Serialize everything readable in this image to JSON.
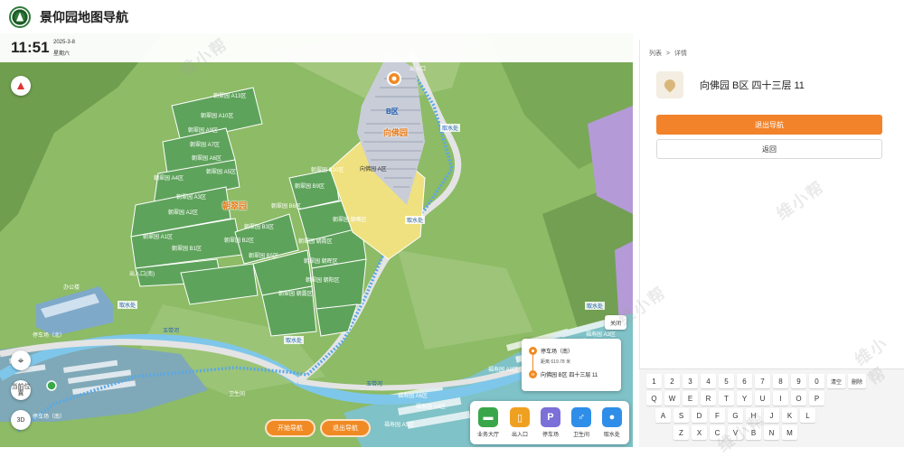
{
  "header": {
    "title": "景仰园地图导航",
    "brand_color": "#2f7a3a"
  },
  "clock": {
    "time": "11:51",
    "date": "2025-3-8",
    "weekday": "星期六"
  },
  "map_controls": {
    "locate_label": "当前位置",
    "mode_label": "3D"
  },
  "map": {
    "area_labels": [
      "朝翠园 A13区",
      "朝翠园 A10区",
      "朝翠园 A9区",
      "朝翠园 A7区",
      "朝翠园 A6区",
      "朝翠园 A5区",
      "朝翠园 A4区",
      "朝翠园 A3区",
      "朝翠园 A2区",
      "朝翠园 A1区",
      "朝翠园 B1区",
      "朝翠园 B2区",
      "朝翠园 B3区",
      "朝翠园 B5区",
      "朝翠园 B6区",
      "朝翠园 B9区",
      "朝翠园 B10区",
      "朝翠园 朝曦区",
      "朝翠园 朝霞区",
      "朝翠园 朝晖区",
      "朝翠园 朝露区",
      "朝翠园 朝阳区",
      "向佛园 A区"
    ],
    "zone_titles": {
      "chaocui": "朝翠园",
      "xiangfo": "向佛园"
    },
    "markers": {
      "b_zone": "B区",
      "entrance_north": "出入口",
      "entrance_south": "出入口(南)",
      "office": "办公楼",
      "parking_north": "停车场（北）",
      "parking_south": "停车场（南）",
      "toilet": "卫生间",
      "river_1": "玉带河",
      "river_2": "玉带河",
      "water_points": [
        "取水处",
        "取水处",
        "取水处",
        "取水处",
        "取水处"
      ],
      "fuyuan": [
        "福寿园 A3区",
        "福寿园 A4区",
        "福寿园 A5区",
        "福寿园 A6区",
        "福寿园 A8区"
      ]
    },
    "close_label": "关闭"
  },
  "route": {
    "start": "停车场（南）",
    "distance": "距离 619.78 米",
    "end": "向佛园 B区 四十三层 11",
    "route_color": "#f08a24"
  },
  "nav_buttons": {
    "start": "开始导航",
    "exit": "退出导航"
  },
  "poi_bar": [
    {
      "label": "业务大厅",
      "icon": "hall-icon",
      "color": "#3aa64a",
      "glyph": "▬"
    },
    {
      "label": "出入口",
      "icon": "door-icon",
      "color": "#f0a020",
      "glyph": "▯"
    },
    {
      "label": "停车场",
      "icon": "parking-icon",
      "color": "#7b6fd8",
      "glyph": "P"
    },
    {
      "label": "卫生间",
      "icon": "toilet-icon",
      "color": "#2f8ee8",
      "glyph": "♂"
    },
    {
      "label": "取水处",
      "icon": "water-icon",
      "color": "#2f8ee8",
      "glyph": "●"
    }
  ],
  "panel": {
    "breadcrumb": [
      "列表",
      ">",
      "详情"
    ],
    "place_name": "向佛园 B区 四十三层 11",
    "exit_button": "退出导航",
    "back_button": "返回",
    "watermark": "维小帮"
  },
  "keyboard": {
    "row1": [
      "1",
      "2",
      "3",
      "4",
      "5",
      "6",
      "7",
      "8",
      "9",
      "0",
      "清空",
      "删除"
    ],
    "row2": [
      "Q",
      "W",
      "E",
      "R",
      "T",
      "Y",
      "U",
      "I",
      "O",
      "P"
    ],
    "row3": [
      "A",
      "S",
      "D",
      "F",
      "G",
      "H",
      "J",
      "K",
      "L"
    ],
    "row4": [
      "Z",
      "X",
      "C",
      "V",
      "B",
      "N",
      "M"
    ]
  }
}
